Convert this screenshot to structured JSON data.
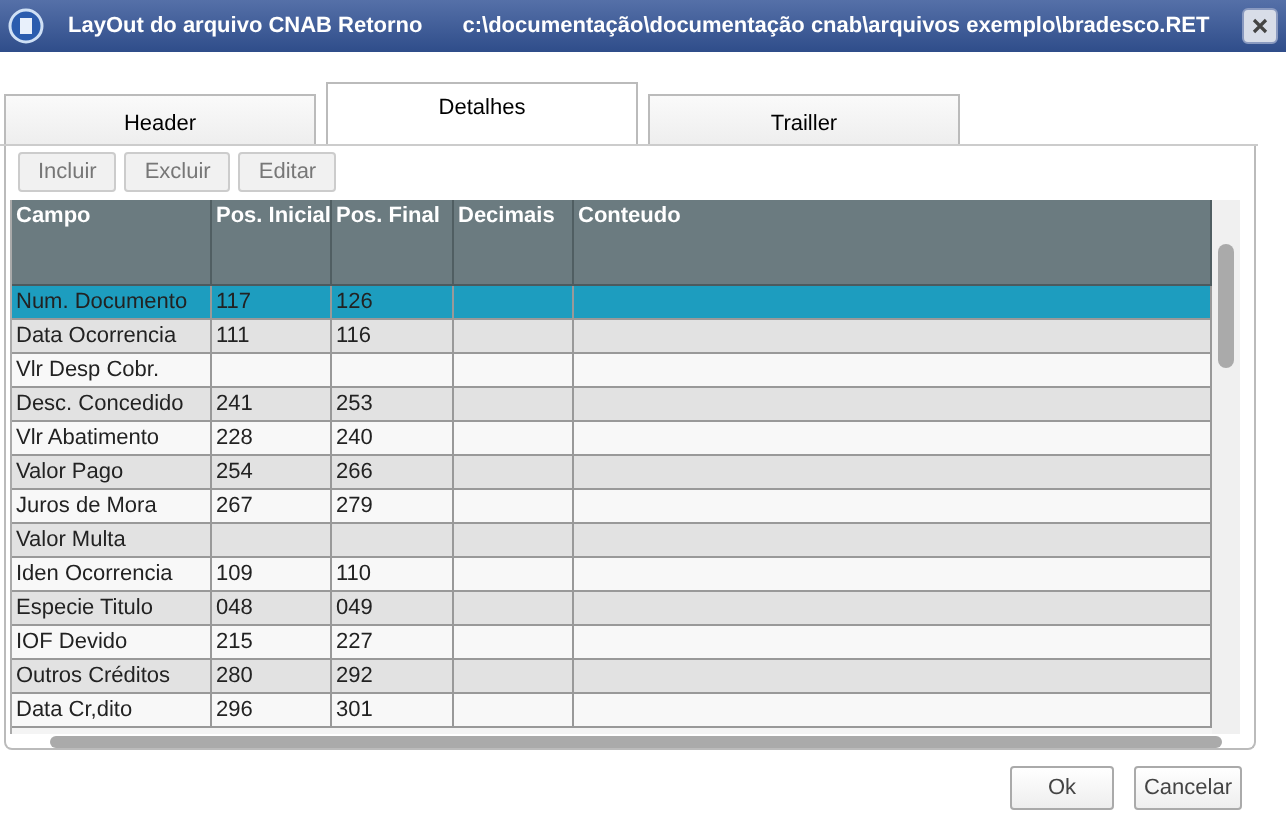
{
  "window": {
    "title": "LayOut do arquivo CNAB Retorno",
    "path": "c:\\documentação\\documentação cnab\\arquivos exemplo\\bradesco.RET"
  },
  "tabs": [
    {
      "label": "Header",
      "selected": false
    },
    {
      "label": "Detalhes",
      "selected": true
    },
    {
      "label": "Trailler",
      "selected": false
    }
  ],
  "toolbar": [
    "Incluir",
    "Excluir",
    "Editar"
  ],
  "table": {
    "columns": [
      "Campo",
      "Pos. Inicial",
      "Pos. Final",
      "Decimais",
      "Conteudo"
    ],
    "rows": [
      {
        "cells": [
          "Num. Documento",
          "117",
          "126",
          "",
          ""
        ],
        "selected": true
      },
      {
        "cells": [
          "Data Ocorrencia",
          "111",
          "116",
          "",
          ""
        ],
        "selected": false
      },
      {
        "cells": [
          "Vlr Desp Cobr.",
          "",
          "",
          "",
          ""
        ],
        "selected": false
      },
      {
        "cells": [
          "Desc. Concedido",
          "241",
          "253",
          "",
          ""
        ],
        "selected": false
      },
      {
        "cells": [
          "Vlr Abatimento",
          "228",
          "240",
          "",
          ""
        ],
        "selected": false
      },
      {
        "cells": [
          "Valor Pago",
          "254",
          "266",
          "",
          ""
        ],
        "selected": false
      },
      {
        "cells": [
          "Juros de Mora",
          "267",
          "279",
          "",
          ""
        ],
        "selected": false
      },
      {
        "cells": [
          "Valor Multa",
          "",
          "",
          "",
          ""
        ],
        "selected": false
      },
      {
        "cells": [
          "Iden Ocorrencia",
          "109",
          "110",
          "",
          ""
        ],
        "selected": false
      },
      {
        "cells": [
          "Especie Titulo",
          "048",
          "049",
          "",
          ""
        ],
        "selected": false
      },
      {
        "cells": [
          "IOF Devido",
          "215",
          "227",
          "",
          ""
        ],
        "selected": false
      },
      {
        "cells": [
          "Outros Créditos",
          "280",
          "292",
          "",
          ""
        ],
        "selected": false
      },
      {
        "cells": [
          "Data Cr,dito",
          "296",
          "301",
          "",
          ""
        ],
        "selected": false
      }
    ]
  },
  "buttons": [
    "Ok",
    "Cancelar"
  ]
}
